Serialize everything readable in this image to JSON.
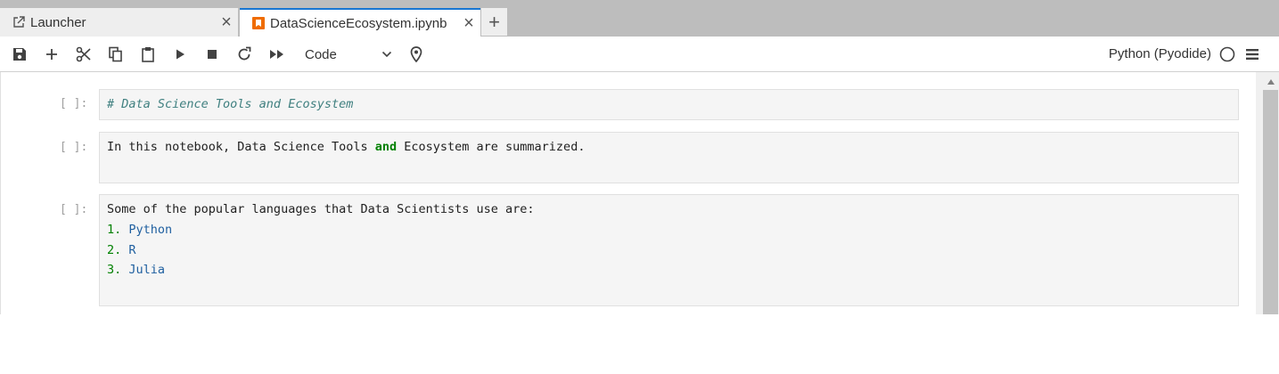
{
  "tabs": [
    {
      "label": "Launcher",
      "icon": "external-link-icon"
    },
    {
      "label": "DataScienceEcosystem.ipynb",
      "icon": "notebook-icon"
    }
  ],
  "toolbar": {
    "cell_type": "Code",
    "kernel_name": "Python (Pyodide)"
  },
  "cells": [
    {
      "prompt": "[ ]:",
      "comment": "# Data Science Tools and Ecosystem"
    },
    {
      "prompt": "[ ]:",
      "before": "In this notebook, Data Science Tools ",
      "keyword": "and",
      "after": " Ecosystem are summarized."
    },
    {
      "prompt": "[ ]:",
      "intro": "Some of the popular languages that Data Scientists use are:",
      "items": [
        {
          "num": "1.",
          "name": "Python"
        },
        {
          "num": "2.",
          "name": "R"
        },
        {
          "num": "3.",
          "name": "Julia"
        }
      ]
    }
  ],
  "colors": {
    "accent": "#1976d2",
    "comment": "#408080",
    "keyword": "#008000",
    "language": "#2060a0"
  }
}
